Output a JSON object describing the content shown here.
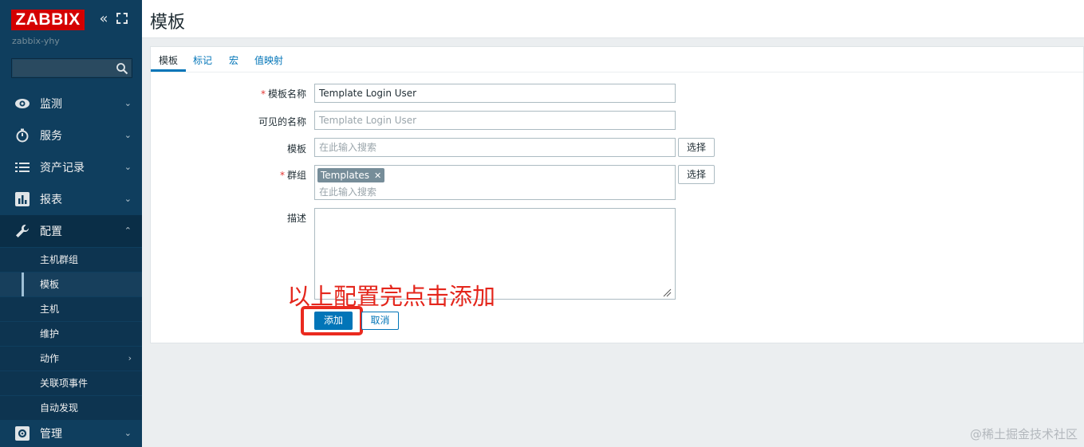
{
  "sidebar": {
    "logo": "ZABBIX",
    "server_name": "zabbix-yhy",
    "search_placeholder": "",
    "menu": [
      {
        "label": "监测",
        "icon": "eye-icon"
      },
      {
        "label": "服务",
        "icon": "stopwatch-icon"
      },
      {
        "label": "资产记录",
        "icon": "list-icon"
      },
      {
        "label": "报表",
        "icon": "bar-chart-icon"
      },
      {
        "label": "配置",
        "icon": "wrench-icon"
      }
    ],
    "submenu": [
      {
        "label": "主机群组"
      },
      {
        "label": "模板"
      },
      {
        "label": "主机"
      },
      {
        "label": "维护"
      },
      {
        "label": "动作"
      },
      {
        "label": "关联项事件"
      },
      {
        "label": "自动发现"
      }
    ],
    "bottom_menu": {
      "label": "管理",
      "icon": "gear-icon"
    }
  },
  "header": {
    "title": "模板"
  },
  "tabs": [
    "模板",
    "标记",
    "宏",
    "值映射"
  ],
  "form": {
    "template_name": {
      "label": "模板名称",
      "value": "Template Login User"
    },
    "visible_name": {
      "label": "可见的名称",
      "placeholder": "Template Login User"
    },
    "templates": {
      "label": "模板",
      "placeholder": "在此输入搜索",
      "button": "选择"
    },
    "groups": {
      "label": "群组",
      "chip": "Templates",
      "placeholder": "在此输入搜索",
      "button": "选择"
    },
    "description": {
      "label": "描述",
      "value": ""
    },
    "add_button": "添加",
    "cancel_button": "取消"
  },
  "annotation": "以上配置完点击添加",
  "watermark": "@稀土掘金技术社区",
  "colors": {
    "sidebar": "#0f3e5e",
    "accent": "#0275b8",
    "logo": "#d40000",
    "annotation": "#e4261c"
  }
}
